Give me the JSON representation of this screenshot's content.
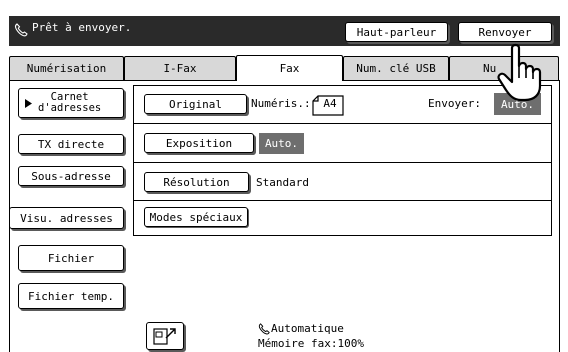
{
  "status": {
    "text": "Prêt à envoyer."
  },
  "top_buttons": {
    "speaker": "Haut-parleur",
    "resend": "Renvoyer"
  },
  "tabs": [
    {
      "label": "Numérisation"
    },
    {
      "label": "I-Fax"
    },
    {
      "label": "Fax"
    },
    {
      "label": "Num. clé USB"
    },
    {
      "label": "Nu"
    }
  ],
  "left": {
    "address_book_line1": "Carnet",
    "address_book_line2": "d'adresses",
    "direct_tx": "TX directe",
    "sub_address": "Sous-adresse",
    "view_addresses": "Visu. adresses",
    "file": "Fichier",
    "quick_file": "Fichier temp."
  },
  "settings": {
    "original_label": "Original",
    "scan_label": "Numéris.:",
    "scan_value": "A4",
    "send_label": "Envoyer:",
    "send_value": "Auto.",
    "exposure_label": "Exposition",
    "exposure_value": "Auto.",
    "resolution_label": "Résolution",
    "resolution_value": "Standard",
    "special_modes_label": "Modes spéciaux"
  },
  "footer": {
    "auto_text": "Automatique",
    "memory_text": "Mémoire fax:100%"
  },
  "icons": {
    "status": "phone-icon",
    "footer_auto": "phone-small-icon",
    "footer_button": "document-arrow-icon",
    "cursor": "hand-pointer-icon"
  }
}
